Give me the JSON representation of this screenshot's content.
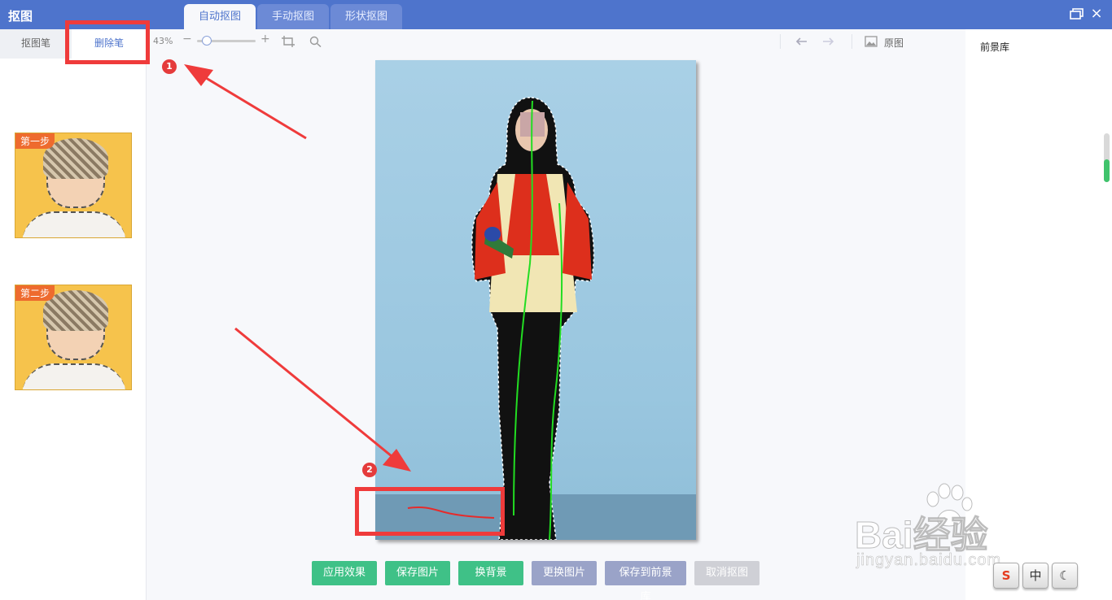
{
  "app": {
    "title": "抠图"
  },
  "tabs": [
    {
      "label": "自动抠图",
      "active": true
    },
    {
      "label": "手动抠图",
      "active": false
    },
    {
      "label": "形状抠图",
      "active": false
    }
  ],
  "left_panel": {
    "pen_tabs": [
      {
        "label": "抠图笔"
      },
      {
        "label": "删除笔",
        "active": true
      }
    ],
    "steps": [
      {
        "label": "第一步"
      },
      {
        "label": "第二步"
      }
    ]
  },
  "toolbar": {
    "zoom": "43%",
    "zoom_level": 0.1,
    "original_label": "原图"
  },
  "actions": {
    "apply": "应用效果",
    "save_image": "保存图片",
    "change_bg": "换背景",
    "replace_image": "更换图片",
    "save_to_library": "保存到前景库",
    "cancel": "取消抠图"
  },
  "right_panel": {
    "title": "前景库"
  },
  "annotations": {
    "badge1": "1",
    "badge2": "2"
  },
  "watermark": {
    "main": "Bai经验",
    "sub": "jingyan.baidu.com"
  },
  "ime": {
    "chinese": "中"
  },
  "colors": {
    "accent": "#4e74cc",
    "green_button": "#3fc187",
    "purple_button": "#9aa3c8",
    "annotation_red": "#ef3b3b",
    "stroke_green": "#22dd22"
  }
}
